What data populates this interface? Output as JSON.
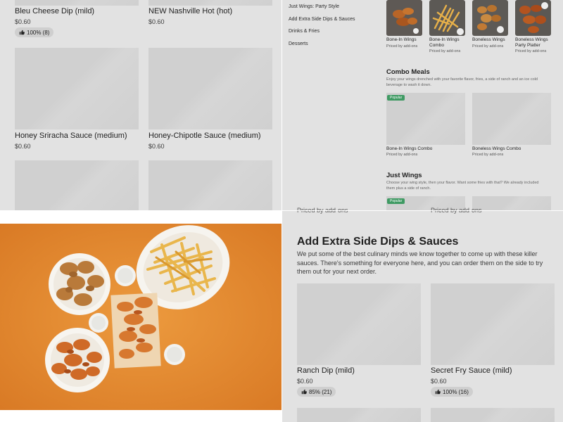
{
  "left_list": {
    "items": [
      {
        "name": "Bleu Cheese Dip (mild)",
        "price": "$0.60",
        "rating": "100% (8)"
      },
      {
        "name": "NEW Nashville Hot (hot)",
        "price": "$0.60"
      },
      {
        "name": "Honey Sriracha Sauce (medium)",
        "price": "$0.60"
      },
      {
        "name": "Honey-Chipotle Sauce (medium)",
        "price": "$0.60"
      }
    ]
  },
  "menu_nav": {
    "items": [
      "Just Wings: Party Style",
      "Add Extra Side Dips & Sauces",
      "Drinks & Fries",
      "Desserts"
    ]
  },
  "categories": [
    {
      "name": "Bone-In Wings",
      "price": "Priced by add-ons"
    },
    {
      "name": "Bone-In Wings Combo",
      "price": "Priced by add-ons"
    },
    {
      "name": "Boneless Wings",
      "price": "Priced by add-ons"
    },
    {
      "name": "Boneless Wings Party Platter",
      "price": "Priced by add-ons"
    }
  ],
  "combo_section": {
    "title": "Combo Meals",
    "description": "Enjoy your wings drenched with your favorite flavor, fries, a side of ranch and an ice cold beverage to wash it down.",
    "badge": "Popular",
    "cards": [
      {
        "name": "Bone-In Wings Combo",
        "price": "Priced by add-ons"
      },
      {
        "name": "Boneless Wings Combo",
        "price": "Priced by add-ons"
      }
    ]
  },
  "just_wings_section": {
    "title": "Just Wings",
    "description": "Choose your wing style, then your flavor. Want some fries with that? We already included them plus a side of ranch.",
    "badge": "Popular"
  },
  "sauces_section": {
    "clipped_text_left": "Priced by add-ons",
    "clipped_text_right": "Priced by add-ons",
    "title": "Add Extra Side Dips & Sauces",
    "description": "We put some of the best culinary minds we know together to come up with these killer sauces. There's something for everyone here, and you can order them on the side to try them out for your next order.",
    "items": [
      {
        "name": "Ranch Dip (mild)",
        "price": "$0.60",
        "rating": "85% (21)"
      },
      {
        "name": "Secret Fry Sauce (mild)",
        "price": "$0.60",
        "rating": "100% (16)"
      }
    ]
  },
  "colors": {
    "overlay_gray": "#e2e2e2",
    "placeholder": "#d0d0d0",
    "popular_badge": "#3f9a63",
    "photo_background": "#e3892f"
  },
  "icons": {
    "rating": "thumbs-up-icon"
  }
}
